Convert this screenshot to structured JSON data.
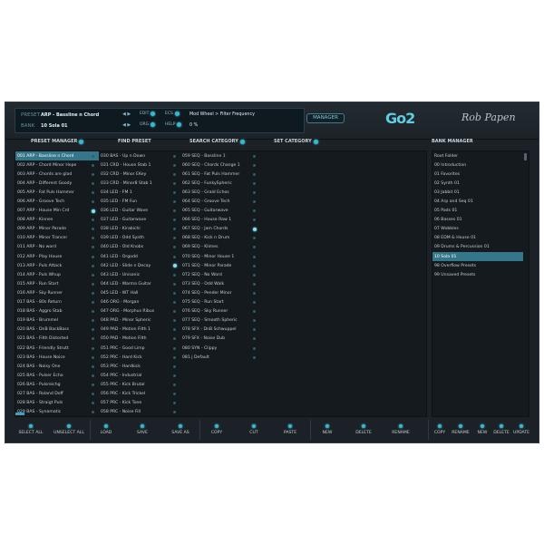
{
  "header": {
    "preset_label": "PRESET",
    "preset_value": "ARP - Bassline n Chord",
    "bank_label": "BANK",
    "bank_value": "10 Sola 01",
    "edit": "EDIT",
    "org": "ORG",
    "ecs": "ECS",
    "help": "HELP",
    "mod_info": "Mod Wheel > Filter Frequency",
    "percent": "0 %",
    "manager_button": "MANAGER",
    "logo": "Go2",
    "signature": "Rob Papen"
  },
  "columns": {
    "preset_manager": "PRESET MANAGER",
    "find_preset": "FIND PRESET",
    "search_category": "SEARCH CATEGORY",
    "set_category": "SET CATEGORY",
    "bank_manager": "BANK MANAGER"
  },
  "presets_col1": [
    "001 ARP - Bassline n Chord",
    "002 ARP - Chord Minor Hope",
    "003 ARP - Chords are glad",
    "004 ARP - Different Goody",
    "005 ARP - Fat Puls Hammer",
    "006 ARP - Groove Tech",
    "007 ARP - House Min Crd",
    "008 ARP - Kinnes",
    "009 ARP - Minor Parade",
    "010 ARP - Minor Trancer",
    "011 ARP - No word",
    "012 ARP - Play House",
    "013 ARP - Puls Attack",
    "014 ARP - Puls Whup",
    "015 ARP - Run Start",
    "016 ARP - Sky Runner",
    "017 BAS - 80s Return",
    "018 BAS - Aggro Stab",
    "019 BAS - Brummel",
    "020 BAS - DnB BackBass",
    "021 BAS - Filth Distorted",
    "022 BAS - Friendly Strutt",
    "023 BAS - House Noice",
    "024 BAS - Noisy One",
    "025 BAS - Pulser Echo",
    "026 BAS - Pulsreichg",
    "027 BAS - Roland Doff",
    "028 BAS - Straigt Puls",
    "029 BAS - Synamatic"
  ],
  "presets_col2": [
    "030 BAS - Up n Down",
    "031 CRD - House Stab 1",
    "032 CRD - Minor EKey",
    "033 CRD - Minor8 Stab 1",
    "034 LED - FM 1",
    "035 LED - FM Fun",
    "036 LED - Guitar Wave",
    "037 LED - Guitarwave",
    "038 LED - Kirabichi",
    "039 LED - Odd Synth",
    "040 LED - Old Knobs",
    "041 LED - Orgodd",
    "042 LED - Slide n Decay",
    "043 LED - Unisonic",
    "044 LED - Warma Guitar",
    "045 LED - WT Hall",
    "046 ORG - Morgan",
    "047 ORG - Morphus Ribus",
    "048 PAD - Minor Spheric",
    "049 PAD - Motion Filth 1",
    "050 PAD - Motion Filth",
    "051 PRC - Good Limp",
    "052 PRC - Hard Kick",
    "053 PRC - Hardkick",
    "054 PRC - Industrial",
    "055 PRC - Kick Brutal",
    "056 PRC - Kick Trickel",
    "057 PRC - Kick Tone",
    "058 PRC - Noise Fill"
  ],
  "presets_col3": [
    "059 SEQ - Bassline 1",
    "060 SEQ - Chords Change 1",
    "061 SEQ - Fat Puls Hammer",
    "062 SEQ - FunkySpheric",
    "063 SEQ - Grald Echos",
    "064 SEQ - Groove Tech",
    "065 SEQ - Guitarwave",
    "066 SEQ - House Raw 1",
    "067 SEQ - Jam Chords",
    "068 SEQ - Kick n Drum",
    "069 SEQ - Klimes",
    "070 SEQ - Minor House 1",
    "071 SEQ - Minor Parade",
    "072 SEQ - No Word",
    "073 SEQ - Odd Walk",
    "074 SEQ - Pender Minor",
    "075 SEQ - Run Start",
    "076 SEQ - Sky Runner",
    "077 SEQ - Smooth Spheric",
    "078 SFX - DnB Schwuppel",
    "079 SFX - Noise Dub",
    "080 SYN - Clippy",
    "081 j Default"
  ],
  "banks": [
    "Root Folder",
    "00 Introduction",
    "01 Favorites",
    "02 Synth 01",
    "03 Jabbit 01",
    "04 Arp and Seq 01",
    "05 Pads 01",
    "06 Basses 01",
    "07 Wobbles",
    "08 EDM & House 01",
    "09 Drums & Percussion 01",
    "10 Sola 01",
    "98 Overflow Presets",
    "99 Unsaved Presets"
  ],
  "footer": {
    "select_all": "SELECT ALL",
    "unselect_all": "UNSELECT ALL",
    "load": "LOAD",
    "save": "SAVE",
    "save_as": "SAVE AS",
    "copy": "COPY",
    "cut": "CUT",
    "paste": "PASTE",
    "new": "NEW",
    "delete": "DELETE",
    "rename": "RENAME",
    "bank_copy": "COPY",
    "bank_rename": "RENAME",
    "bank_new": "NEW",
    "bank_delete": "DELETE",
    "bank_update": "UPDATE"
  },
  "state": {
    "selected_preset_index": 0,
    "selected_bank_index": 11,
    "category_markers_col1": [
      6
    ],
    "category_markers_col2": [
      12
    ],
    "category_markers_col3": [
      8
    ]
  },
  "colors": {
    "accent": "#35b8d4",
    "selection": "#35778a",
    "background": "#1b2126"
  }
}
